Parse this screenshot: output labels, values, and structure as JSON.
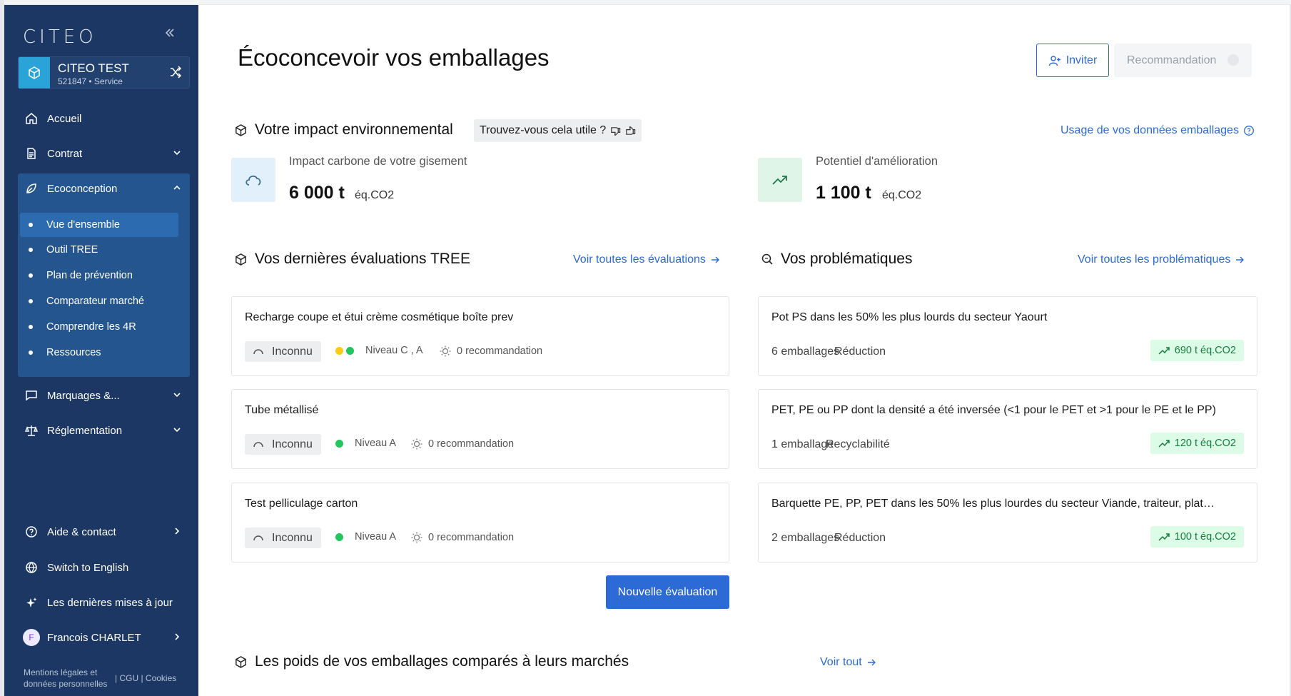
{
  "sidebar": {
    "logo": "CITEO",
    "org": {
      "name": "CITEO TEST",
      "sub": "521847 • Service"
    },
    "items": {
      "accueil": "Accueil",
      "contrat": "Contrat",
      "ecoconception": "Ecoconception",
      "marquages": "Marquages &...",
      "reglementation": "Réglementation",
      "aide": "Aide & contact",
      "english": "Switch to English",
      "updates": "Les dernières mises à jour",
      "user": "Francois CHARLET",
      "user_initial": "F"
    },
    "sub_items": [
      "Vue d'ensemble",
      "Outil TREE",
      "Plan de prévention",
      "Comparateur marché",
      "Comprendre les 4R",
      "Ressources"
    ],
    "legal": {
      "mentions": "Mentions légales et données personnelles",
      "cgu": "| CGU | Cookies"
    }
  },
  "main": {
    "title": "Écoconcevoir vos emballages",
    "invite_label": "Inviter",
    "reco_label": "Recommandation",
    "impact": {
      "title": "Votre impact environnemental",
      "useful": "Trouvez-vous cela utile ?",
      "data_link": "Usage de vos données emballages",
      "kpi1_label": "Impact carbone de votre gisement",
      "kpi1_value": "6 000 t",
      "kpi1_unit": "éq.CO2",
      "kpi2_label": "Potentiel d'amélioration",
      "kpi2_value": "1 100 t",
      "kpi2_unit": "éq.CO2"
    },
    "evaluations": {
      "title": "Vos dernières évaluations TREE",
      "link": "Voir toutes les évaluations",
      "cards": [
        {
          "title": "Recharge coupe et étui crème cosmétique boîte prev",
          "status": "Inconnu",
          "level": "Niveau C , A",
          "reco": "0 recommandation"
        },
        {
          "title": "Tube métallisé",
          "status": "Inconnu",
          "level": "Niveau A",
          "reco": "0 recommandation"
        },
        {
          "title": "Test pelliculage carton",
          "status": "Inconnu",
          "level": "Niveau A",
          "reco": "0 recommandation"
        }
      ],
      "new_button": "Nouvelle évaluation"
    },
    "problems": {
      "title": "Vos problématiques",
      "link": "Voir toutes les problématiques",
      "cards": [
        {
          "title": "Pot PS dans les 50% les plus lourds du secteur Yaourt",
          "count": "6 emballages",
          "tag": "Réduction",
          "gain": "690 t éq.CO2"
        },
        {
          "title": "PET, PE ou PP dont la densité a été inversée (<1 pour le PET et >1 pour le PE et le PP)",
          "count": "1 emballage",
          "tag": "Recyclabilité",
          "gain": "120 t éq.CO2"
        },
        {
          "title": "Barquette PE, PP, PET dans les 50% les plus lourdes du secteur Viande, traiteur, plat…",
          "count": "2 emballages",
          "tag": "Réduction",
          "gain": "100 t éq.CO2"
        }
      ]
    },
    "weights": {
      "title": "Les poids de vos emballages comparés à leurs marchés",
      "link": "Voir tout"
    }
  },
  "colors": {
    "sidebar": "#1c3764",
    "accent": "#2c6bd6",
    "green_badge": "#dcfce7"
  }
}
